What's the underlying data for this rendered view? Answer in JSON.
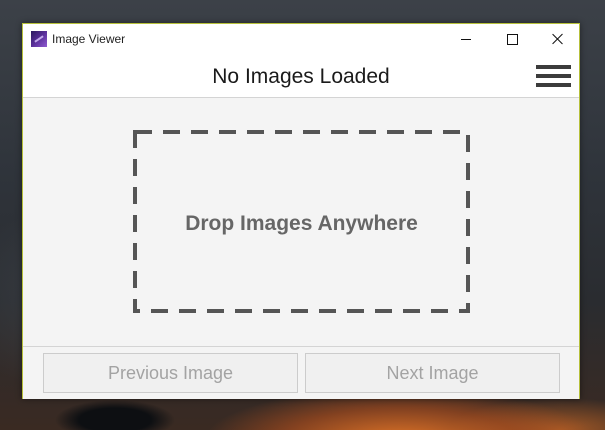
{
  "window": {
    "title": "Image Viewer",
    "app_icon": "image-viewer-app-icon",
    "controls": [
      "minimize-icon",
      "maximize-icon",
      "close-icon"
    ]
  },
  "header": {
    "title": "No Images Loaded",
    "menu_icon": "hamburger-menu-icon"
  },
  "drop_zone": {
    "text": "Drop Images Anywhere"
  },
  "footer": {
    "previous_label": "Previous Image",
    "next_label": "Next Image"
  },
  "colors": {
    "window_border": "#b6c03a",
    "content_background": "#f4f4f4",
    "drop_text": "#666666",
    "disabled_text": "#a3a3a3"
  }
}
